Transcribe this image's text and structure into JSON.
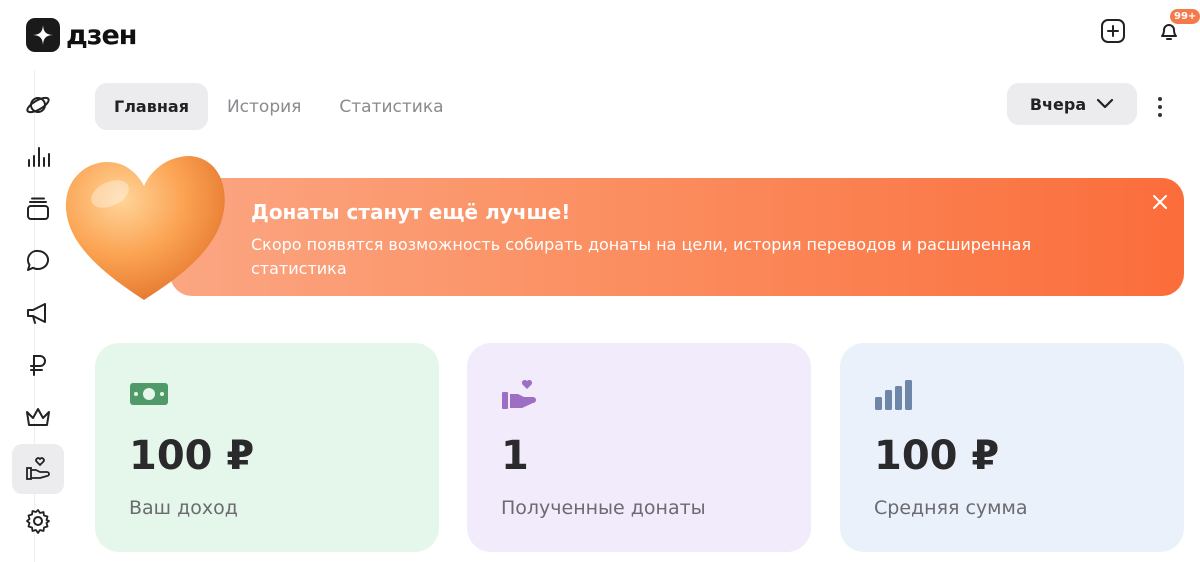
{
  "header": {
    "logo_text": "дзен",
    "notifications_badge": "99+"
  },
  "sidebar": {
    "items": [
      {
        "icon": "planet-icon"
      },
      {
        "icon": "stats-icon"
      },
      {
        "icon": "stack-icon"
      },
      {
        "icon": "comments-icon"
      },
      {
        "icon": "megaphone-icon"
      },
      {
        "icon": "ruble-icon"
      },
      {
        "icon": "crown-icon"
      },
      {
        "icon": "donate-icon",
        "active": true
      },
      {
        "icon": "gear-icon"
      }
    ]
  },
  "tabs": [
    {
      "label": "Главная",
      "active": true
    },
    {
      "label": "История",
      "active": false
    },
    {
      "label": "Статистика",
      "active": false
    }
  ],
  "period": {
    "selected": "Вчера"
  },
  "banner": {
    "title": "Донаты станут ещё лучше!",
    "text": "Скоро появятся возможность собирать донаты на цели, история переводов и расширенная статистика"
  },
  "cards": [
    {
      "value": "100 ₽",
      "label": "Ваш доход",
      "icon": "cash-icon",
      "color": "#4f9a68"
    },
    {
      "value": "1",
      "label": "Полученные донаты",
      "icon": "donation-hand-icon",
      "color": "#9c6fc4"
    },
    {
      "value": "100 ₽",
      "label": "Средняя сумма",
      "icon": "bar-chart-icon",
      "color": "#6e86a8"
    }
  ],
  "colors": {
    "banner_start": "#fba682",
    "banner_end": "#fb6d3b",
    "badge": "#f47a4c"
  }
}
